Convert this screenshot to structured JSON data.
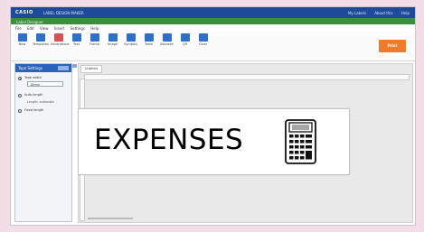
{
  "app": {
    "logo": "CASIO",
    "title": "LABEL DESIGN MAKER",
    "header_links": [
      "My Labels",
      "About this",
      "Help"
    ],
    "subtitle": "Label Designer"
  },
  "menu": [
    "File",
    "Edit",
    "View",
    "Insert",
    "Settings",
    "Help"
  ],
  "ribbon": [
    {
      "label": "New",
      "icon": "new-doc-icon",
      "color": "#2f6fc4"
    },
    {
      "label": "Templates",
      "icon": "templates-icon",
      "color": "#2f6fc4"
    },
    {
      "label": "Illustrations",
      "icon": "illustrations-icon",
      "color": "#d35454"
    },
    {
      "label": "Text",
      "icon": "text-icon",
      "color": "#2f6fc4"
    },
    {
      "label": "Frame",
      "icon": "frame-icon",
      "color": "#2f6fc4"
    },
    {
      "label": "Image",
      "icon": "image-icon",
      "color": "#2f6fc4"
    },
    {
      "label": "Symbols",
      "icon": "symbols-icon",
      "color": "#2f6fc4"
    },
    {
      "label": "Table",
      "icon": "table-icon",
      "color": "#2f6fc4"
    },
    {
      "label": "Barcode",
      "icon": "barcode-icon",
      "color": "#2f6fc4"
    },
    {
      "label": "QR",
      "icon": "qr-icon",
      "color": "#2f6fc4"
    },
    {
      "label": "Clear",
      "icon": "clear-icon",
      "color": "#2f6fc4"
    }
  ],
  "print_button": "Print",
  "panel": {
    "header": "Tape Settings",
    "options": [
      {
        "label": "Tape width",
        "field": "18mm",
        "selected": true
      },
      {
        "label": "Auto length",
        "field": "",
        "selected": false,
        "note": "Length: automatic"
      },
      {
        "label": "Fixed length",
        "field": "",
        "selected": false
      }
    ]
  },
  "document": {
    "tab": "Untitled",
    "label_text": "EXPENSES",
    "image": "calculator-icon"
  },
  "colors": {
    "brand_bar": "#1d4b9a",
    "green_bar": "#3a8f3c",
    "print_button": "#f07b2b",
    "page_bg": "#f3dde6"
  }
}
